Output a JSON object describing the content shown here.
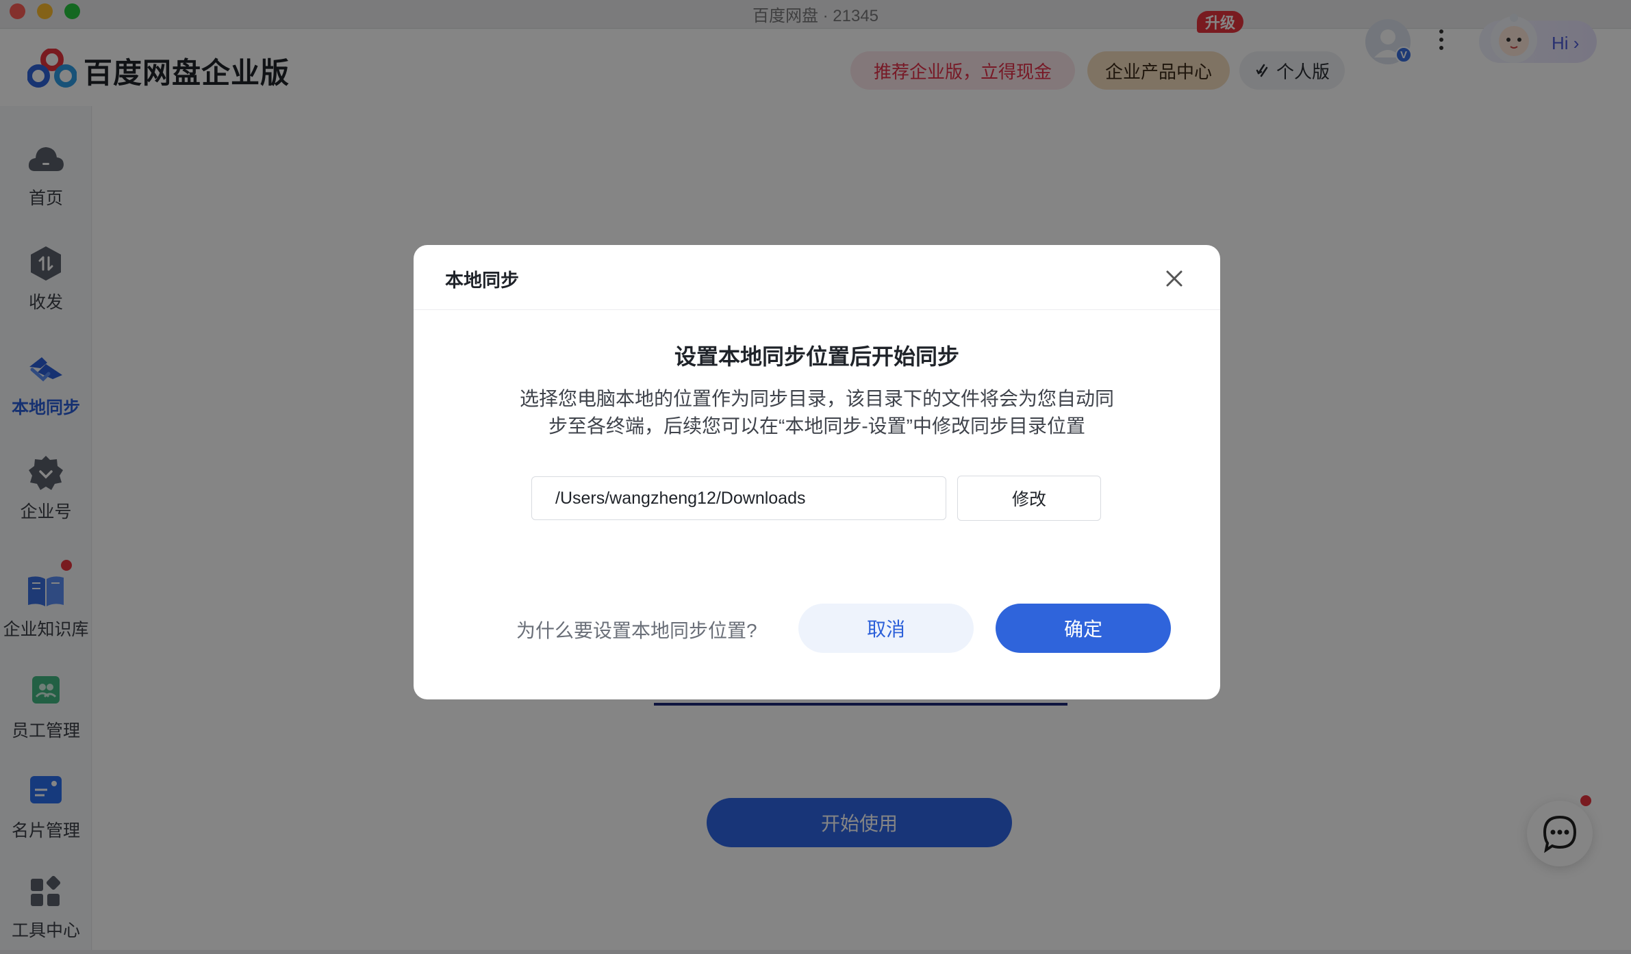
{
  "window": {
    "title": "百度网盘 · 21345"
  },
  "header": {
    "brand": "百度网盘企业版",
    "promo_label": "推荐企业版，立得现金",
    "products_label": "企业产品中心",
    "upgrade_badge": "升级",
    "personal_label": "个人版",
    "avatar_badge": "V",
    "hi_label": "Hi ›"
  },
  "sidebar": {
    "items": [
      {
        "label": "首页",
        "icon": "cloud-icon"
      },
      {
        "label": "收发",
        "icon": "transfer-icon"
      },
      {
        "label": "本地同步",
        "icon": "sync-icon",
        "active": true
      },
      {
        "label": "企业号",
        "icon": "enterprise-icon"
      },
      {
        "label": "企业知识库",
        "icon": "book-icon",
        "has_notification": true
      },
      {
        "label": "员工管理",
        "icon": "staff-icon"
      },
      {
        "label": "名片管理",
        "icon": "card-icon"
      },
      {
        "label": "工具中心",
        "icon": "tools-icon"
      }
    ]
  },
  "main": {
    "start_label": "开始使用"
  },
  "modal": {
    "title": "本地同步",
    "heading": "设置本地同步位置后开始同步",
    "description_line1": "选择您电脑本地的位置作为同步目录，该目录下的文件将会为您自动同",
    "description_line2": "步至各终端，后续您可以在“本地同步-设置”中修改同步目录位置",
    "path_value": "/Users/wangzheng12/Downloads",
    "modify_label": "修改",
    "why_label": "为什么要设置本地同步位置?",
    "cancel_label": "取消",
    "confirm_label": "确定"
  },
  "colors": {
    "accent": "#2f64db",
    "promo": "#e5304a",
    "badge": "#e8353f"
  }
}
